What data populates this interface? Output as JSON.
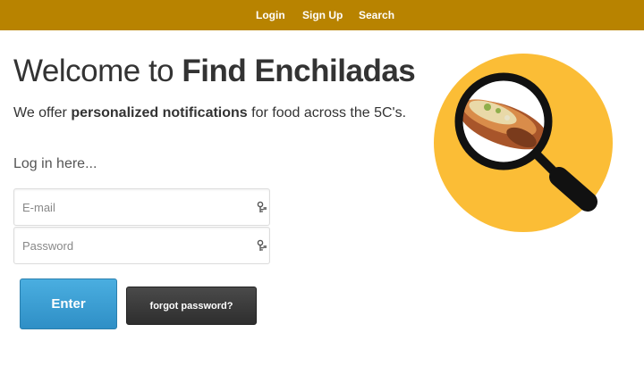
{
  "nav": {
    "login": "Login",
    "signup": "Sign Up",
    "search": "Search"
  },
  "hero": {
    "title_prefix": "Welcome to ",
    "title_brand": "Find Enchiladas",
    "subtitle_prefix": "We offer ",
    "subtitle_bold": "personalized notifications",
    "subtitle_suffix": " for food across the 5C's."
  },
  "login": {
    "heading": "Log in here...",
    "email_placeholder": "E-mail",
    "password_placeholder": "Password",
    "enter_label": "Enter",
    "forgot_label": "forgot password?"
  },
  "logo": {
    "icon": "magnifier-enchilada-logo",
    "circle_color": "#fbbd36",
    "glass_color": "#111111"
  },
  "theme": {
    "topbar_color": "#b88300",
    "primary_button": "#3a9fd6",
    "secondary_button": "#3a3a3a"
  }
}
